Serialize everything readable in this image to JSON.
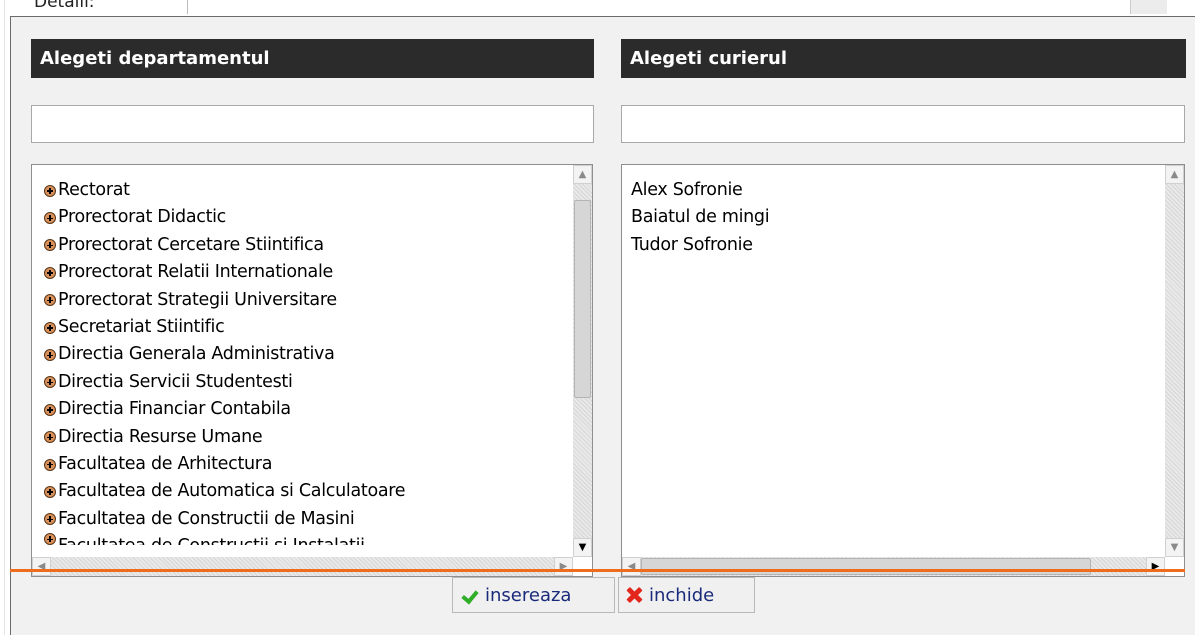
{
  "backdrop": {
    "label": "Detalii:"
  },
  "departments": {
    "header": "Alegeti departamentul",
    "filter_value": "",
    "items": [
      "Rectorat",
      "Prorectorat Didactic",
      "Prorectorat Cercetare Stiintifica",
      "Prorectorat Relatii Internationale",
      "Prorectorat Strategii Universitare",
      "Secretariat Stiintific",
      "Directia Generala Administrativa",
      "Directia Servicii Studentesti",
      "Directia Financiar Contabila",
      "Directia Resurse Umane",
      "Facultatea de Arhitectura",
      "Facultatea de Automatica si Calculatoare",
      "Facultatea de Constructii de Masini",
      "Facultatea de Constructii si Instalatii"
    ]
  },
  "couriers": {
    "header": "Alegeti curierul",
    "filter_value": "",
    "items": [
      "Alex Sofronie",
      "Baiatul de mingi",
      "Tudor Sofronie"
    ]
  },
  "actions": {
    "insert_label": "insereaza",
    "close_label": "inchide"
  },
  "icons": {
    "expand": "plus-circle-icon",
    "insert": "checkmark-icon",
    "close": "x-icon"
  },
  "colors": {
    "header_bg": "#2b2b2b",
    "accent_rule": "#ef6c1e",
    "insert_icon": "#2fae27",
    "close_icon": "#e3261c",
    "button_text": "#1a2a7a"
  }
}
